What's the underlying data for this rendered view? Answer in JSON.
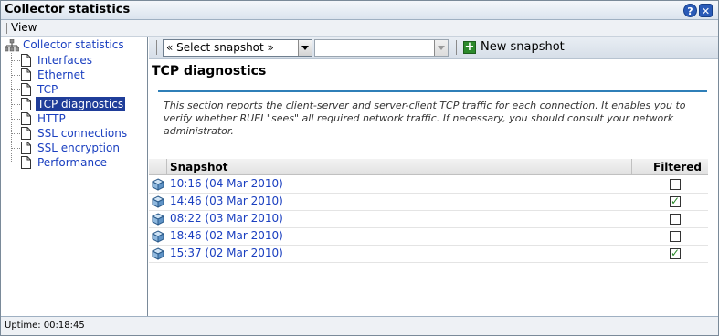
{
  "window": {
    "title": "Collector statistics",
    "help_icon": "help-icon",
    "close_icon": "close-icon"
  },
  "menubar": {
    "view_label": "View"
  },
  "sidebar": {
    "root_label": "Collector statistics",
    "root_icon": "tree-network-icon",
    "items": [
      {
        "label": "Interfaces"
      },
      {
        "label": "Ethernet"
      },
      {
        "label": "TCP"
      },
      {
        "label": "TCP diagnostics"
      },
      {
        "label": "HTTP"
      },
      {
        "label": "SSL connections"
      },
      {
        "label": "SSL encryption"
      },
      {
        "label": "Performance"
      }
    ],
    "selected_index": 3
  },
  "toolbar": {
    "snapshot_select": "« Select snapshot »",
    "second_select": "",
    "new_snapshot_label": "New snapshot",
    "new_snapshot_icon": "plus-icon"
  },
  "main": {
    "title": "TCP diagnostics",
    "description": "This section reports the client-server and server-client TCP traffic for each connection. It enables you to verify whether RUEI \"sees\" all required network traffic. If necessary, you should consult your network administrator."
  },
  "grid": {
    "columns": {
      "snapshot": "Snapshot",
      "filtered": "Filtered"
    },
    "rows": [
      {
        "snapshot": "10:16 (04 Mar 2010)",
        "filtered": false
      },
      {
        "snapshot": "14:46 (03 Mar 2010)",
        "filtered": true
      },
      {
        "snapshot": "08:22 (03 Mar 2010)",
        "filtered": false
      },
      {
        "snapshot": "18:46 (02 Mar 2010)",
        "filtered": false
      },
      {
        "snapshot": "15:37 (02 Mar 2010)",
        "filtered": true
      }
    ]
  },
  "status": {
    "text": "Uptime: 00:18:45"
  },
  "colors": {
    "link": "#1a3fc0",
    "selected_bg": "#1f3d99",
    "accent_rule": "#2f7fb8",
    "check_green": "#2a8a2a"
  }
}
